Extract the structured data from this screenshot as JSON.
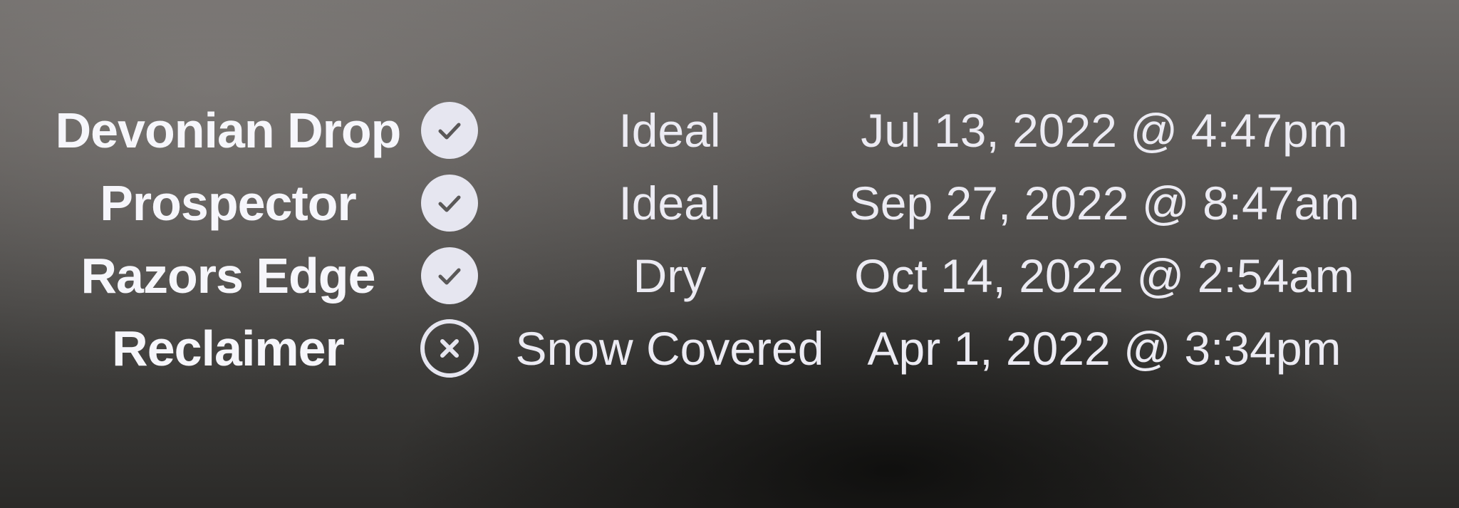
{
  "trails": [
    {
      "name": "Devonian Drop",
      "status_icon": "check-circle-icon",
      "condition": "Ideal",
      "updated": "Jul 13, 2022 @ 4:47pm"
    },
    {
      "name": "Prospector",
      "status_icon": "check-circle-icon",
      "condition": "Ideal",
      "updated": "Sep 27, 2022 @ 8:47am"
    },
    {
      "name": "Razors Edge",
      "status_icon": "check-circle-icon",
      "condition": "Dry",
      "updated": "Oct 14, 2022 @ 2:54am"
    },
    {
      "name": "Reclaimer",
      "status_icon": "x-circle-icon",
      "condition": "Snow Covered",
      "updated": "Apr 1, 2022 @ 3:34pm"
    }
  ],
  "colors": {
    "text": "#eeeef4",
    "icon_fill": "#e6e6f0",
    "icon_glyph": "#5a5858"
  }
}
